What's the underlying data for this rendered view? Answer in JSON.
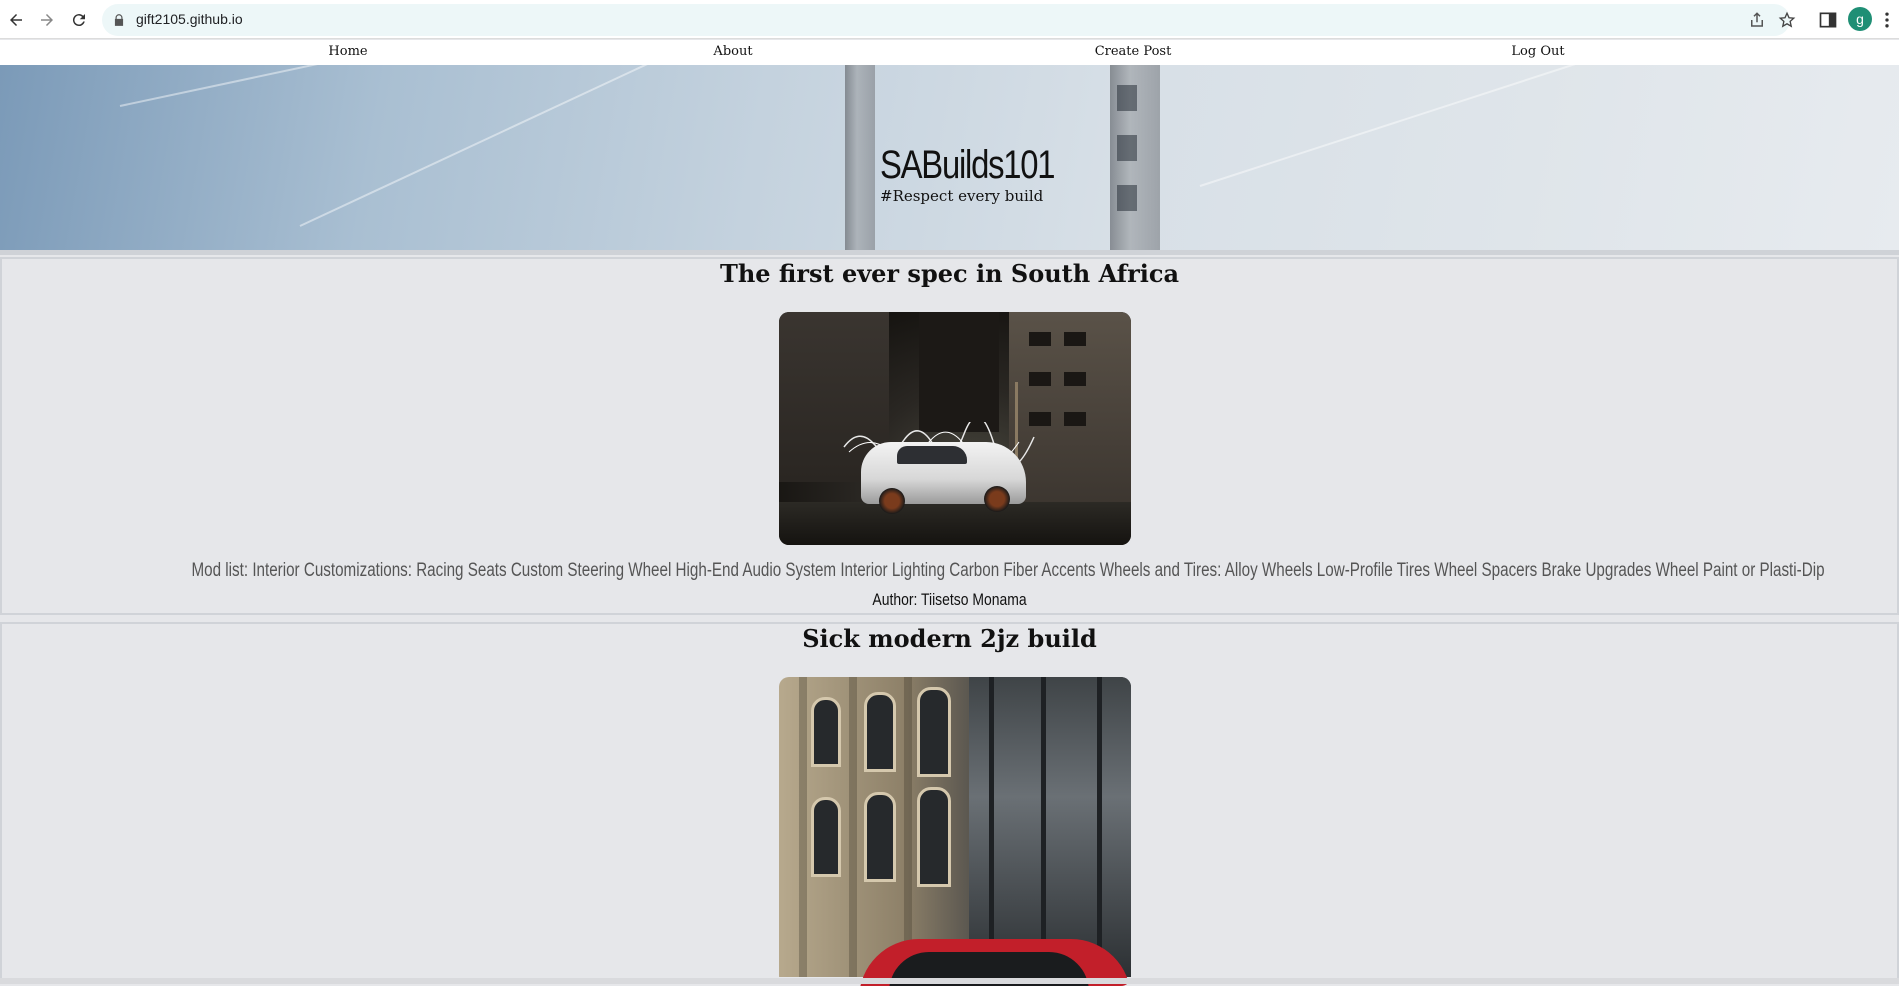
{
  "browser": {
    "url": "gift2105.github.io",
    "profile_initial": "g"
  },
  "nav": {
    "items": [
      "Home",
      "About",
      "Create Post",
      "Log Out"
    ]
  },
  "hero": {
    "title": "SABuilds101",
    "tagline": "#Respect every build"
  },
  "posts": [
    {
      "title": "The first ever spec in South Africa",
      "body": "Mod list: Interior Customizations: Racing Seats Custom Steering Wheel High-End Audio System Interior Lighting Carbon Fiber Accents Wheels and Tires: Alloy Wheels Low-Profile Tires Wheel Spacers Brake Upgrades Wheel Paint or Plasti-Dip",
      "author": "Author: Tiisetso Monama"
    },
    {
      "title": "Sick modern 2jz build"
    }
  ],
  "colors": {
    "page_bg": "#e6e7ea",
    "nav_bg": "#ffffff",
    "omnibox_bg": "#edf7f8",
    "avatar_bg": "#1f8f75",
    "car2_red": "#c21f2a"
  }
}
